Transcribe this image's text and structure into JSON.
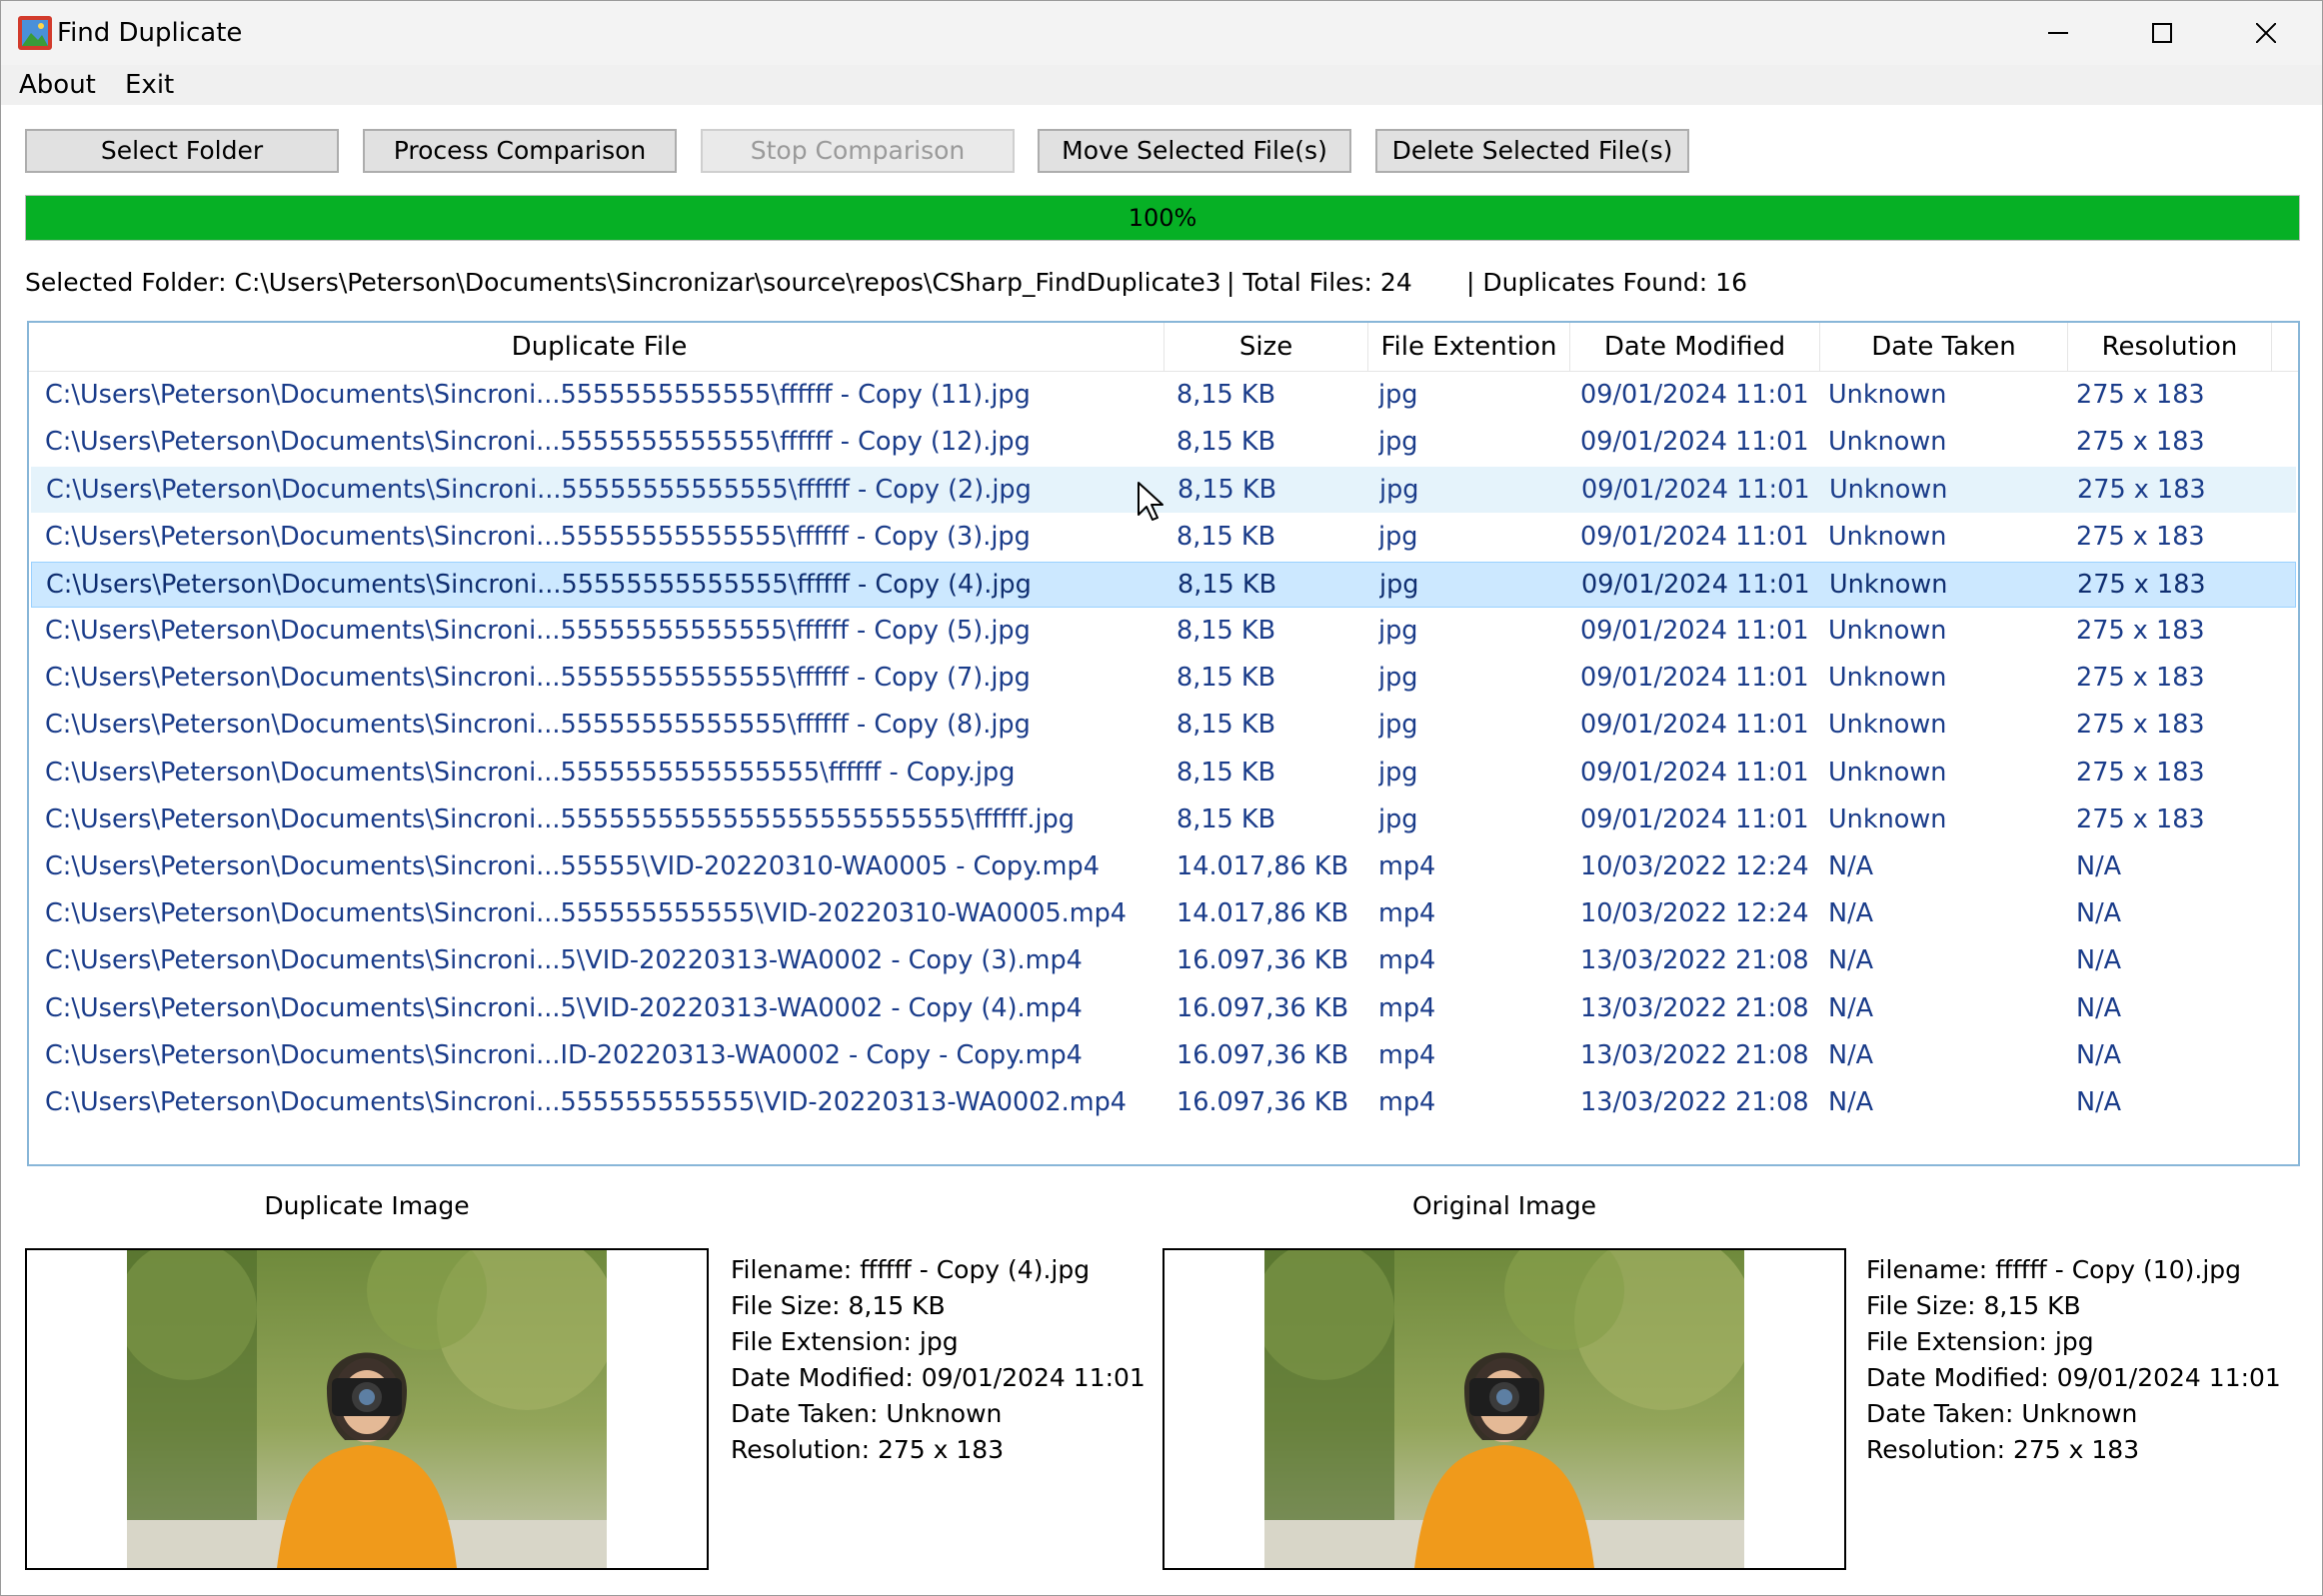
{
  "window": {
    "title": "Find Duplicate"
  },
  "menu": [
    "About",
    "Exit"
  ],
  "toolbar": {
    "select_folder": "Select Folder",
    "process_comparison": "Process Comparison",
    "stop_comparison": "Stop Comparison",
    "move_selected": "Move Selected File(s)",
    "delete_selected": "Delete Selected File(s)"
  },
  "progress": {
    "value": 1.0,
    "label": "100%",
    "color": "#06b025"
  },
  "status": {
    "selected_folder": "Selected Folder: C:\\Users\\Peterson\\Documents\\Sincronizar\\source\\repos\\CSharp_FindDuplicate3",
    "total_files": "|  Total Files: 24",
    "duplicates_found": "|  Duplicates Found: 16"
  },
  "table": {
    "columns": [
      "Duplicate File",
      "Size",
      "File Extention",
      "Date Modified",
      "Date Taken",
      "Resolution"
    ],
    "rows": [
      [
        "C:\\Users\\Peterson\\Documents\\Sincroni...5555555555555\\ffffff - Copy (11).jpg",
        "8,15 KB",
        "jpg",
        "09/01/2024 11:01",
        "Unknown",
        "275 x 183"
      ],
      [
        "C:\\Users\\Peterson\\Documents\\Sincroni...5555555555555\\ffffff - Copy (12).jpg",
        "8,15 KB",
        "jpg",
        "09/01/2024 11:01",
        "Unknown",
        "275 x 183"
      ],
      [
        "C:\\Users\\Peterson\\Documents\\Sincroni...55555555555555\\ffffff - Copy (2).jpg",
        "8,15 KB",
        "jpg",
        "09/01/2024 11:01",
        "Unknown",
        "275 x 183"
      ],
      [
        "C:\\Users\\Peterson\\Documents\\Sincroni...55555555555555\\ffffff - Copy (3).jpg",
        "8,15 KB",
        "jpg",
        "09/01/2024 11:01",
        "Unknown",
        "275 x 183"
      ],
      [
        "C:\\Users\\Peterson\\Documents\\Sincroni...55555555555555\\ffffff - Copy (4).jpg",
        "8,15 KB",
        "jpg",
        "09/01/2024 11:01",
        "Unknown",
        "275 x 183"
      ],
      [
        "C:\\Users\\Peterson\\Documents\\Sincroni...55555555555555\\ffffff - Copy (5).jpg",
        "8,15 KB",
        "jpg",
        "09/01/2024 11:01",
        "Unknown",
        "275 x 183"
      ],
      [
        "C:\\Users\\Peterson\\Documents\\Sincroni...55555555555555\\ffffff - Copy (7).jpg",
        "8,15 KB",
        "jpg",
        "09/01/2024 11:01",
        "Unknown",
        "275 x 183"
      ],
      [
        "C:\\Users\\Peterson\\Documents\\Sincroni...55555555555555\\ffffff - Copy (8).jpg",
        "8,15 KB",
        "jpg",
        "09/01/2024 11:01",
        "Unknown",
        "275 x 183"
      ],
      [
        "C:\\Users\\Peterson\\Documents\\Sincroni...5555555555555555\\ffffff - Copy.jpg",
        "8,15 KB",
        "jpg",
        "09/01/2024 11:01",
        "Unknown",
        "275 x 183"
      ],
      [
        "C:\\Users\\Peterson\\Documents\\Sincroni...5555555555555555555555555\\ffffff.jpg",
        "8,15 KB",
        "jpg",
        "09/01/2024 11:01",
        "Unknown",
        "275 x 183"
      ],
      [
        "C:\\Users\\Peterson\\Documents\\Sincroni...55555\\VID-20220310-WA0005 - Copy.mp4",
        "14.017,86 KB",
        "mp4",
        "10/03/2022 12:24",
        "N/A",
        "N/A"
      ],
      [
        "C:\\Users\\Peterson\\Documents\\Sincroni...555555555555\\VID-20220310-WA0005.mp4",
        "14.017,86 KB",
        "mp4",
        "10/03/2022 12:24",
        "N/A",
        "N/A"
      ],
      [
        "C:\\Users\\Peterson\\Documents\\Sincroni...5\\VID-20220313-WA0002 - Copy (3).mp4",
        "16.097,36 KB",
        "mp4",
        "13/03/2022 21:08",
        "N/A",
        "N/A"
      ],
      [
        "C:\\Users\\Peterson\\Documents\\Sincroni...5\\VID-20220313-WA0002 - Copy (4).mp4",
        "16.097,36 KB",
        "mp4",
        "13/03/2022 21:08",
        "N/A",
        "N/A"
      ],
      [
        "C:\\Users\\Peterson\\Documents\\Sincroni...ID-20220313-WA0002 - Copy - Copy.mp4",
        "16.097,36 KB",
        "mp4",
        "13/03/2022 21:08",
        "N/A",
        "N/A"
      ],
      [
        "C:\\Users\\Peterson\\Documents\\Sincroni...555555555555\\VID-20220313-WA0002.mp4",
        "16.097,36 KB",
        "mp4",
        "13/03/2022 21:08",
        "N/A",
        "N/A"
      ]
    ],
    "hover_row": 2,
    "selected_row": 4
  },
  "duplicate": {
    "label": "Duplicate Image",
    "filename": "Filename: ffffff - Copy (4).jpg",
    "size": "File Size: 8,15 KB",
    "extension": "File Extension: jpg",
    "modified": "Date Modified: 09/01/2024 11:01",
    "taken": "Date Taken: Unknown",
    "resolution": "Resolution: 275 x 183"
  },
  "original": {
    "label": "Original Image",
    "filename": "Filename: ffffff - Copy (10).jpg",
    "size": "File Size: 8,15 KB",
    "extension": "File Extension: jpg",
    "modified": "Date Modified: 09/01/2024 11:01",
    "taken": "Date Taken: Unknown",
    "resolution": "Resolution: 275 x 183"
  }
}
